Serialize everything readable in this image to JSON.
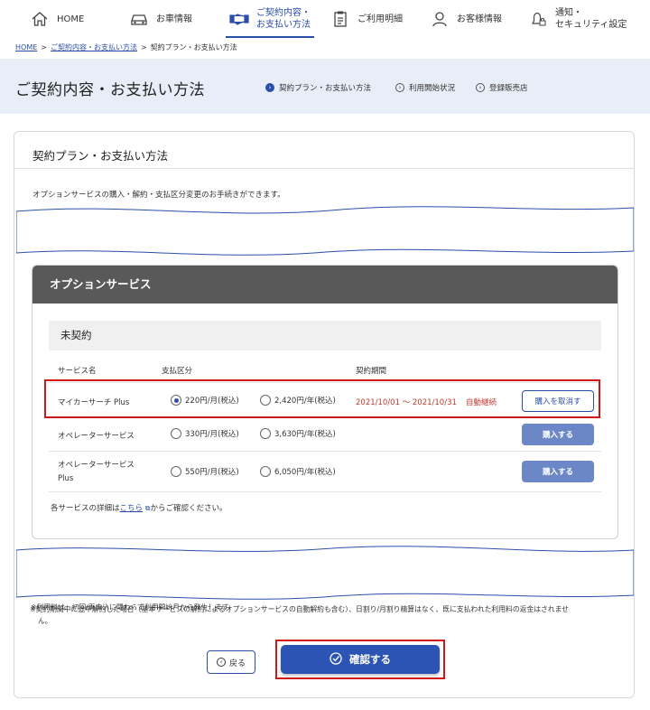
{
  "nav": {
    "home": "HOME",
    "vehicle": "お車情報",
    "contract_line1": "ご契約内容・",
    "contract_line2": "お支払い方法",
    "usage": "ご利用明細",
    "customer": "お客様情報",
    "notify_line1": "通知・",
    "notify_line2": "セキュリティ設定"
  },
  "breadcrumb": {
    "home": "HOME",
    "sep": ">",
    "contract": "ご契約内容・お支払い方法",
    "current": "契約プラン・お支払い方法"
  },
  "hero": {
    "title": "ご契約内容・お支払い方法",
    "subnav": [
      "契約プラン・お支払い方法",
      "利用開始状況",
      "登録販売店"
    ]
  },
  "card": {
    "title": "契約プラン・お支払い方法",
    "description": "オプションサービスの購入・解約・支払区分変更のお手続きができます。"
  },
  "option_panel": {
    "title": "オプションサービス",
    "status": "未契約",
    "columns": {
      "service": "サービス名",
      "payment": "支払区分",
      "period": "契約期間"
    },
    "rows": [
      {
        "name": "マイカーサーチ Plus",
        "monthly": "220円/月(税込)",
        "yearly": "2,420円/年(税込)",
        "period": "2021/10/01 〜 2021/10/31",
        "auto": "自動継続",
        "action": "購入を取消す"
      },
      {
        "name": "オペレーターサービス",
        "monthly": "330円/月(税込)",
        "yearly": "3,630円/年(税込)",
        "action": "購入する"
      },
      {
        "name_line1": "オペレーターサービス",
        "name_line2": "Plus",
        "monthly": "550円/月(税込)",
        "yearly": "6,050円/年(税込)",
        "action": "購入する"
      }
    ],
    "detail_prefix": "各サービスの詳細は",
    "detail_link": "こちら",
    "detail_suffix": "からご確認ください。"
  },
  "notes": {
    "line1": "※利用料は、初回/再申込に関わらず利用開始月から発生します。",
    "line2": "※契約期間中に途中解約した場合（基本サービスの解約によるオプションサービスの自動解約も含む）、日割り/月割り精算はなく、既に支払われた利用料の返金はされませ",
    "line3": "ん。"
  },
  "buttons": {
    "back": "戻る",
    "confirm": "確認する"
  },
  "colors": {
    "accent": "#2b54b4",
    "highlight": "#d01818",
    "period_text": "#c0392b"
  }
}
